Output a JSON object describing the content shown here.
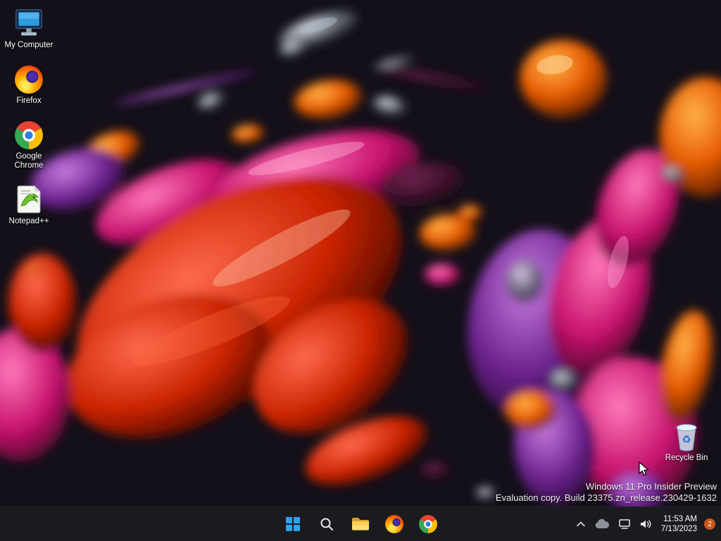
{
  "colors": {
    "taskbar_bg": "#1b1c20",
    "badge": "#c8561a",
    "start_blue": "#2ba3ef",
    "wallpaper_palette": [
      "#141019",
      "#e85d04",
      "#d42a00",
      "#d11873",
      "#7a2a95",
      "#6a7078"
    ]
  },
  "desktop": {
    "icons": [
      {
        "label": "My Computer",
        "icon": "my-computer-icon"
      },
      {
        "label": "Firefox",
        "icon": "firefox-icon"
      },
      {
        "label": "Google Chrome",
        "icon": "chrome-icon"
      },
      {
        "label": "Notepad++",
        "icon": "notepadpp-icon"
      }
    ],
    "recycle_bin": {
      "label": "Recycle Bin",
      "icon": "recycle-bin-icon"
    },
    "watermark": {
      "line1": "Windows 11 Pro Insider Preview",
      "line2": "Evaluation copy. Build 23375.zn_release.230429-1632"
    }
  },
  "taskbar": {
    "buttons": [
      {
        "icon": "windows-start-icon"
      },
      {
        "icon": "search-icon"
      },
      {
        "icon": "file-explorer-icon"
      },
      {
        "icon": "firefox-icon"
      },
      {
        "icon": "chrome-icon"
      }
    ],
    "tray": {
      "icons": [
        "chevron-up-icon",
        "onedrive-cloud-icon",
        "network-icon",
        "volume-icon"
      ],
      "time": "11:53 AM",
      "date": "7/13/2023",
      "notification_count": "2"
    }
  }
}
